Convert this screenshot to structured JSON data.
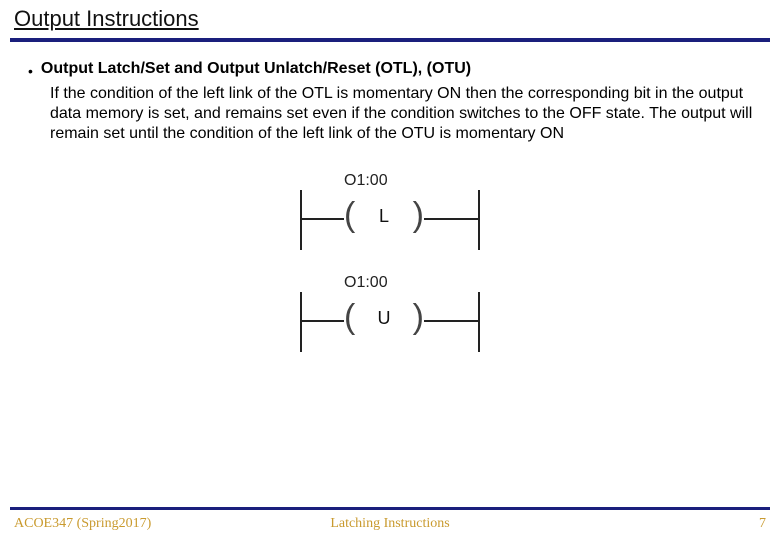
{
  "title": "Output Instructions",
  "bullet": {
    "heading": "Output Latch/Set and Output Unlatch/Reset (OTL), (OTU)",
    "body": "If the condition of the left link of the OTL is momentary ON then the corresponding bit in the output data memory is set, and remains set even if the condition switches to the OFF state. The output will remain set until the condition of the left link of the OTU is momentary ON"
  },
  "diagrams": [
    {
      "address": "O1:00",
      "letter": "L"
    },
    {
      "address": "O1:00",
      "letter": "U"
    }
  ],
  "footer": {
    "left": "ACOE347 (Spring2017)",
    "center": "Latching Instructions",
    "page": "7"
  },
  "colors": {
    "accent": "#1a1f7c",
    "footer_text": "#c99a2e"
  }
}
